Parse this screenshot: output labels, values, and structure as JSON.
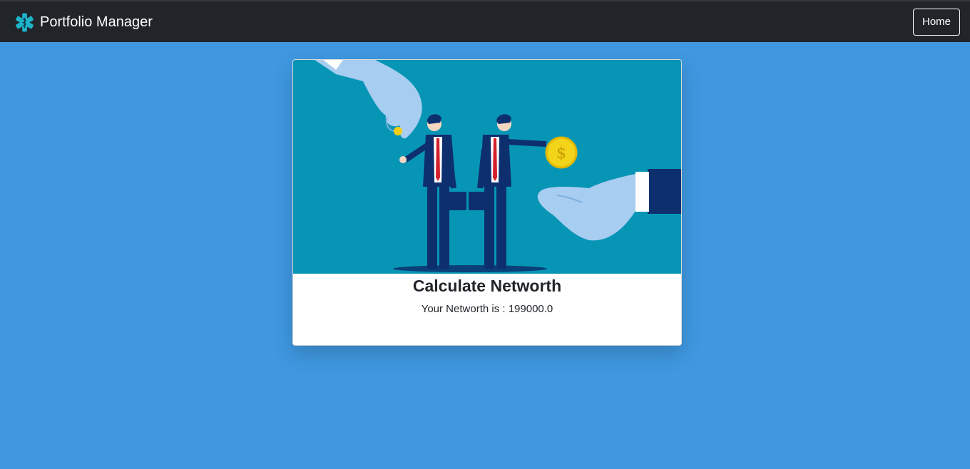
{
  "navbar": {
    "brand_title": "Portfolio Manager",
    "brand_icon": "medical-star-icon",
    "home_label": "Home",
    "background": "#212529"
  },
  "main": {
    "background": "#3f98e0",
    "card": {
      "illustration": "businessmen-exchanging-coins-illustration",
      "title": "Calculate Networth",
      "result_text": "Your Networth is : 199000.0"
    }
  }
}
